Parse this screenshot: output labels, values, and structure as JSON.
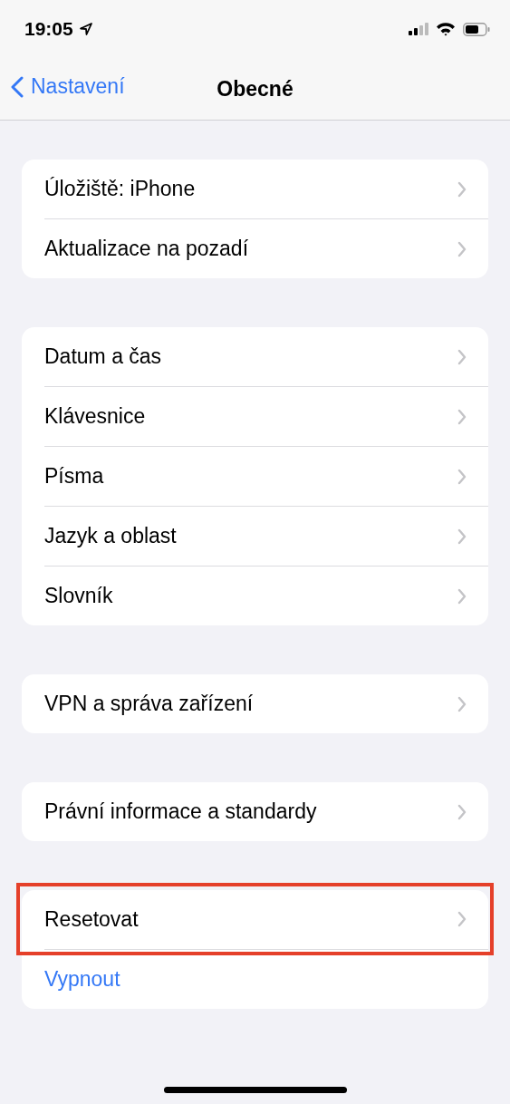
{
  "status_bar": {
    "time": "19:05"
  },
  "nav_bar": {
    "back": "Nastavení",
    "title": "Obecné"
  },
  "groups": [
    {
      "items": [
        {
          "label": "Úložiště: iPhone",
          "kind": "link",
          "highlighted": false
        },
        {
          "label": "Aktualizace na pozadí",
          "kind": "link",
          "highlighted": false
        }
      ]
    },
    {
      "items": [
        {
          "label": "Datum a čas",
          "kind": "link",
          "highlighted": false
        },
        {
          "label": "Klávesnice",
          "kind": "link",
          "highlighted": false
        },
        {
          "label": "Písma",
          "kind": "link",
          "highlighted": false
        },
        {
          "label": "Jazyk a oblast",
          "kind": "link",
          "highlighted": false
        },
        {
          "label": "Slovník",
          "kind": "link",
          "highlighted": false
        }
      ]
    },
    {
      "items": [
        {
          "label": "VPN a správa zařízení",
          "kind": "link",
          "highlighted": false
        }
      ]
    },
    {
      "items": [
        {
          "label": "Právní informace a standardy",
          "kind": "link",
          "highlighted": false
        }
      ]
    },
    {
      "items": [
        {
          "label": "Resetovat",
          "kind": "link",
          "highlighted": true
        },
        {
          "label": "Vypnout",
          "kind": "action",
          "highlighted": false
        }
      ]
    }
  ]
}
